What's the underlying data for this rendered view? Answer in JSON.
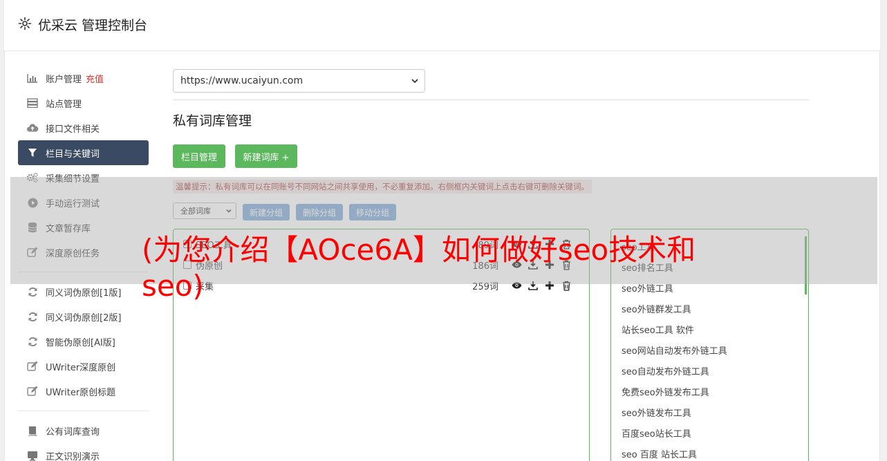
{
  "header": {
    "title": "优采云 管理控制台",
    "icon": "gear-icon"
  },
  "sidebar": {
    "items": [
      {
        "label": "账户管理",
        "extra": "充值",
        "icon": "bar-chart-icon"
      },
      {
        "label": "站点管理",
        "icon": "server-icon"
      },
      {
        "label": "接口文件相关",
        "icon": "cloud-upload-icon"
      },
      {
        "label": "栏目与关键词",
        "icon": "filter-icon",
        "active": true
      },
      {
        "label": "采集细节设置",
        "icon": "cogs-icon"
      },
      {
        "label": "手动运行测试",
        "icon": "play-icon"
      },
      {
        "label": "文章暂存库",
        "icon": "database-icon"
      },
      {
        "label": "深度原创任务",
        "icon": "edit-icon"
      },
      {
        "label": "同义词伪原创[1版]",
        "icon": "refresh-icon"
      },
      {
        "label": "同义词伪原创[2版]",
        "icon": "refresh-icon"
      },
      {
        "label": "智能伪原创[AI版]",
        "icon": "refresh-icon"
      },
      {
        "label": "UWriter深度原创",
        "icon": "edit-icon"
      },
      {
        "label": "UWriter原创标题",
        "icon": "edit-icon"
      },
      {
        "label": "公有词库查询",
        "icon": "book-icon"
      },
      {
        "label": "正文识别演示",
        "icon": "monitor-icon"
      }
    ]
  },
  "main": {
    "site_select_value": "https://www.ucaiyun.com",
    "section_title": "私有词库管理",
    "btn_columns": "栏目管理",
    "btn_new_lib": "新建词库 +",
    "hint": "温馨提示：私有词库可以在同账号不同网站之间共享使用，不必重复添加。右侧框内关键词上点击右键可删除关键词。",
    "filter_value": "全部词库",
    "btn_new_group": "新建分组",
    "btn_del_group": "删除分组",
    "btn_move_group": "移动分组",
    "libraries": [
      {
        "name": "SEO工具",
        "count": "89词"
      },
      {
        "name": "伪原创",
        "count": "186词"
      },
      {
        "name": "采集",
        "count": "259词"
      }
    ],
    "keywords": [
      "seo工具",
      "seo排名工具",
      "seo外链工具",
      "seo外链群发工具",
      "站长seo工具 软件",
      "seo网站自动发布外链工具",
      "seo自动发布外链工具",
      "免费seo外链发布工具",
      "seo外链发布工具",
      "百度seo站长工具",
      "seo 百度 站长工具"
    ]
  },
  "overlay": {
    "text": "(为您介绍【AOce6A】如何做好seo技术和seo)"
  }
}
